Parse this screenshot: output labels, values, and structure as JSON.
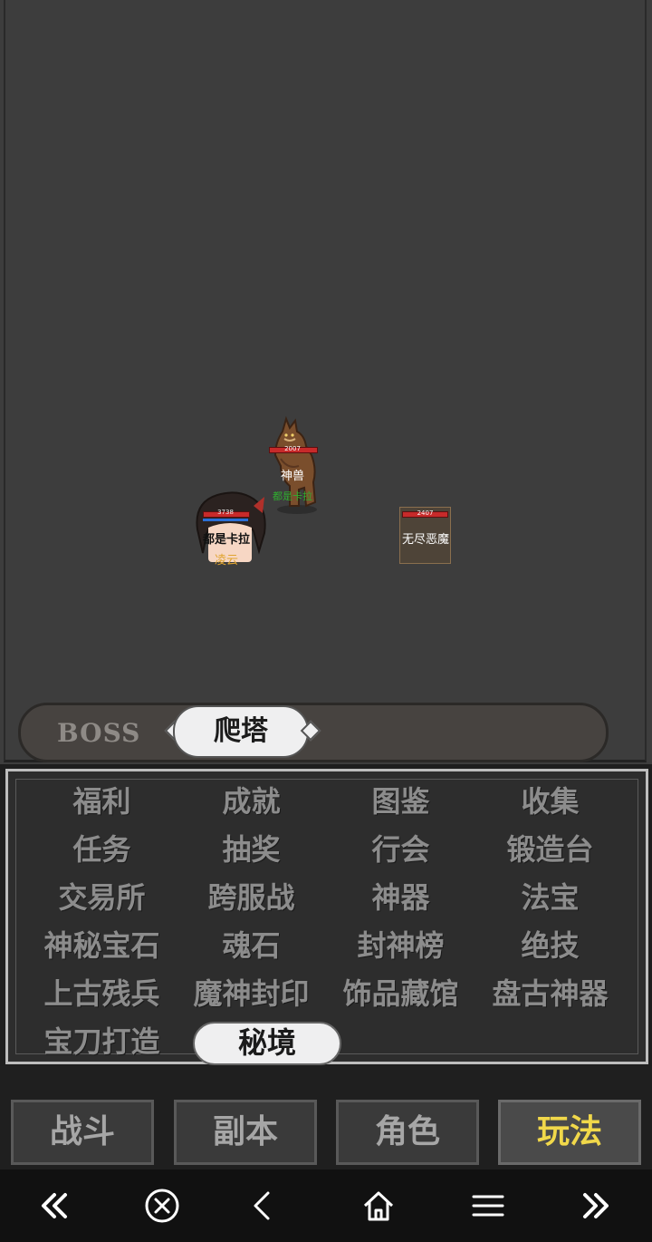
{
  "battle": {
    "beast": {
      "hp": "2007",
      "name": "神兽",
      "owner": "都是卡拉"
    },
    "hero": {
      "hp": "3738",
      "name": "都是卡拉",
      "title": "凌云"
    },
    "enemy": {
      "hp": "2407",
      "name": "无尽恶魔"
    }
  },
  "modes": {
    "boss_label": "BOSS",
    "active_label": "爬塔"
  },
  "menu": {
    "items": [
      "福利",
      "成就",
      "图鉴",
      "收集",
      "任务",
      "抽奖",
      "行会",
      "锻造台",
      "交易所",
      "跨服战",
      "神器",
      "法宝",
      "神秘宝石",
      "魂石",
      "封神榜",
      "绝技",
      "上古残兵",
      "魔神封印",
      "饰品藏馆",
      "盘古神器",
      "宝刀打造"
    ],
    "active_label": "秘境"
  },
  "tabs": [
    {
      "label": "战斗"
    },
    {
      "label": "副本"
    },
    {
      "label": "角色"
    },
    {
      "label": "玩法"
    }
  ],
  "navbar": {
    "icons": [
      "double-chevron-left-icon",
      "close-circle-icon",
      "back-chevron-icon",
      "home-icon",
      "menu-icon",
      "double-chevron-right-icon"
    ]
  },
  "colors": {
    "active_tab_text": "#f1d84a",
    "inactive_text": "#8c8c8c",
    "battle_bg": "#3d3d3d"
  }
}
